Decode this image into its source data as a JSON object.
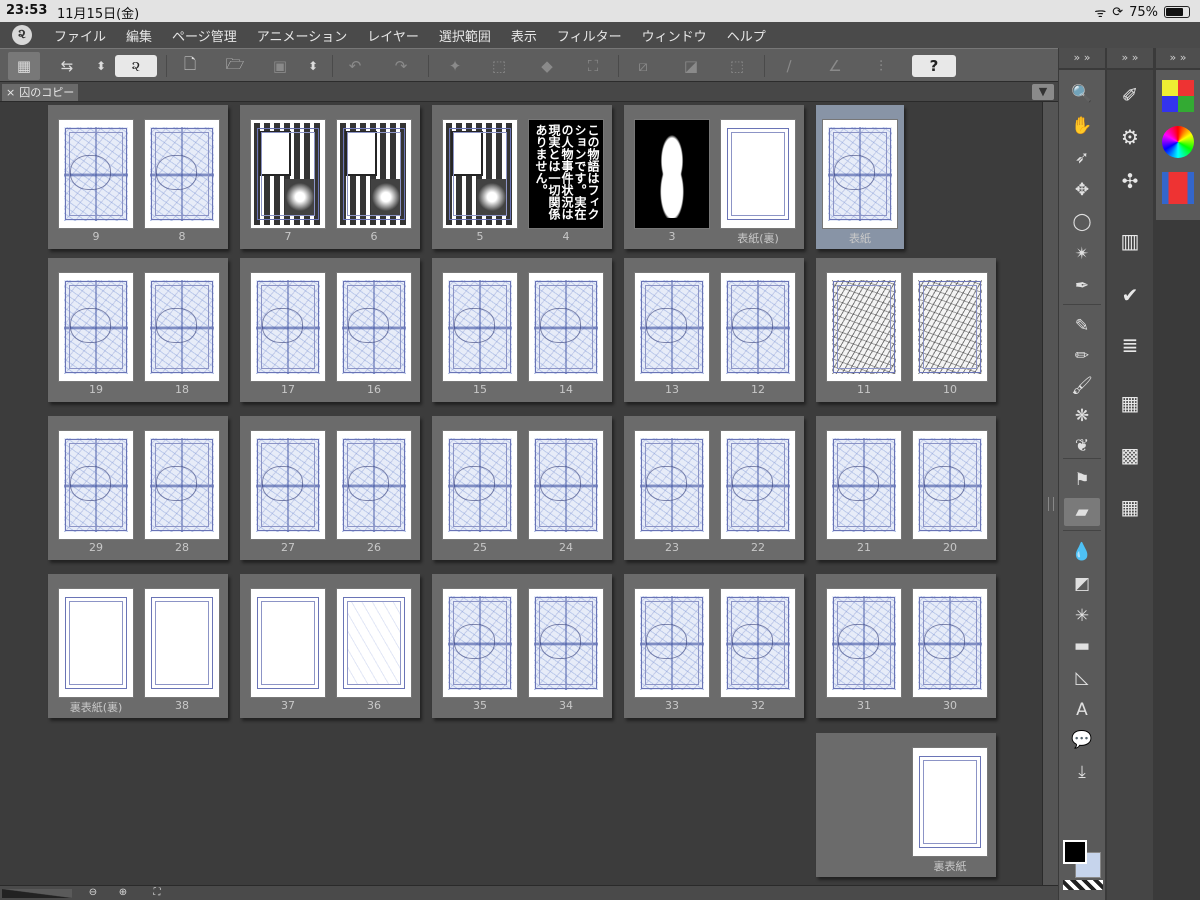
{
  "status": {
    "time": "23:53",
    "date": "11月15日(金)",
    "battery": "75%",
    "battery_level": 0.75
  },
  "menu": [
    "ファイル",
    "編集",
    "ページ管理",
    "アニメーション",
    "レイヤー",
    "選択範囲",
    "表示",
    "フィルター",
    "ウィンドウ",
    "ヘルプ"
  ],
  "toolbar": {
    "help_label": "?"
  },
  "tab": {
    "close": "×",
    "title": "囚のコピー",
    "menu": "▼"
  },
  "spreads": [
    {
      "pages": [
        {
          "label": "9",
          "style": "sketch"
        },
        {
          "label": "8",
          "style": "sketch"
        }
      ]
    },
    {
      "pages": [
        {
          "label": "7",
          "style": "ink"
        },
        {
          "label": "6",
          "style": "ink"
        }
      ]
    },
    {
      "pages": [
        {
          "label": "5",
          "style": "ink"
        },
        {
          "label": "4",
          "style": "black-text",
          "text": "この物語はフィクションです。実在の人物事件状況は現実とは一切関係ありません。"
        }
      ]
    },
    {
      "pages": [
        {
          "label": "3",
          "style": "black-figure"
        },
        {
          "label": "表紙(裏)",
          "style": "blank"
        }
      ]
    },
    {
      "pages": [
        {
          "label": "表紙",
          "style": "sketch"
        }
      ],
      "selected": true
    },
    {
      "pages": [
        {
          "label": "19",
          "style": "sketch"
        },
        {
          "label": "18",
          "style": "sketch"
        }
      ]
    },
    {
      "pages": [
        {
          "label": "17",
          "style": "sketch"
        },
        {
          "label": "16",
          "style": "sketch"
        }
      ]
    },
    {
      "pages": [
        {
          "label": "15",
          "style": "sketch"
        },
        {
          "label": "14",
          "style": "sketch"
        }
      ]
    },
    {
      "pages": [
        {
          "label": "13",
          "style": "sketch"
        },
        {
          "label": "12",
          "style": "sketch"
        }
      ]
    },
    {
      "pages": [
        {
          "label": "11",
          "style": "ink-light"
        },
        {
          "label": "10",
          "style": "ink-light"
        }
      ]
    },
    {
      "pages": [
        {
          "label": "29",
          "style": "sketch"
        },
        {
          "label": "28",
          "style": "sketch"
        }
      ]
    },
    {
      "pages": [
        {
          "label": "27",
          "style": "sketch"
        },
        {
          "label": "26",
          "style": "sketch"
        }
      ]
    },
    {
      "pages": [
        {
          "label": "25",
          "style": "sketch"
        },
        {
          "label": "24",
          "style": "sketch"
        }
      ]
    },
    {
      "pages": [
        {
          "label": "23",
          "style": "sketch"
        },
        {
          "label": "22",
          "style": "sketch"
        }
      ]
    },
    {
      "pages": [
        {
          "label": "21",
          "style": "sketch"
        },
        {
          "label": "20",
          "style": "sketch"
        }
      ]
    },
    {
      "pages": [
        {
          "label": "裏表紙(裏)",
          "style": "blank"
        },
        {
          "label": "38",
          "style": "blank"
        }
      ]
    },
    {
      "pages": [
        {
          "label": "37",
          "style": "blank"
        },
        {
          "label": "36",
          "style": "faint"
        }
      ]
    },
    {
      "pages": [
        {
          "label": "35",
          "style": "sketch"
        },
        {
          "label": "34",
          "style": "sketch"
        }
      ]
    },
    {
      "pages": [
        {
          "label": "33",
          "style": "sketch"
        },
        {
          "label": "32",
          "style": "sketch"
        }
      ]
    },
    {
      "pages": [
        {
          "label": "31",
          "style": "sketch"
        },
        {
          "label": "30",
          "style": "sketch"
        }
      ]
    },
    {
      "pages": [
        {
          "label": "裏表紙",
          "style": "blank"
        }
      ]
    }
  ],
  "tools": [
    {
      "name": "zoom-icon",
      "glyph": "🔍"
    },
    {
      "name": "hand-icon",
      "glyph": "✋"
    },
    {
      "name": "operation-icon",
      "glyph": "➶"
    },
    {
      "name": "move-layer-icon",
      "glyph": "✥"
    },
    {
      "name": "selection-icon",
      "glyph": "◯"
    },
    {
      "name": "auto-select-icon",
      "glyph": "✴"
    },
    {
      "name": "eyedropper-icon",
      "glyph": "✒"
    },
    {
      "name": "pen-icon",
      "glyph": "✎"
    },
    {
      "name": "pencil-icon",
      "glyph": "✏"
    },
    {
      "name": "brush-icon",
      "glyph": "🖌"
    },
    {
      "name": "airbrush-icon",
      "glyph": "❋"
    },
    {
      "name": "decoration-icon",
      "glyph": "❦"
    },
    {
      "name": "fill-tool-icon",
      "glyph": "⚑"
    },
    {
      "name": "eraser-icon",
      "glyph": "▰"
    },
    {
      "name": "blend-icon",
      "glyph": "💧"
    },
    {
      "name": "gradient-icon",
      "glyph": "◩"
    },
    {
      "name": "figure-icon",
      "glyph": "✳"
    },
    {
      "name": "frame-border-icon",
      "glyph": "▬"
    },
    {
      "name": "ruler-icon",
      "glyph": "◺"
    },
    {
      "name": "text-icon",
      "glyph": "A"
    },
    {
      "name": "balloon-icon",
      "glyph": "💬"
    },
    {
      "name": "line-correction-icon",
      "glyph": "⤓"
    }
  ],
  "subtools": [
    {
      "name": "subtool-pen-icon",
      "glyph": "✐"
    },
    {
      "name": "subtool-gear-icon",
      "glyph": "⚙"
    },
    {
      "name": "subtool-preset-icon",
      "glyph": "✣"
    },
    {
      "name": "subtool-fill-icon",
      "glyph": "▥"
    },
    {
      "name": "subtool-stroke-icon",
      "glyph": "✔"
    },
    {
      "name": "subtool-layers-icon",
      "glyph": "≣"
    },
    {
      "name": "subtool-frame-icon",
      "glyph": "▦"
    },
    {
      "name": "subtool-checker-icon",
      "glyph": "▩"
    },
    {
      "name": "subtool-tone-icon",
      "glyph": "▦"
    }
  ],
  "colors": {
    "main": "#000000",
    "sub": "#c6d4ec",
    "accent": "#8894a6"
  }
}
